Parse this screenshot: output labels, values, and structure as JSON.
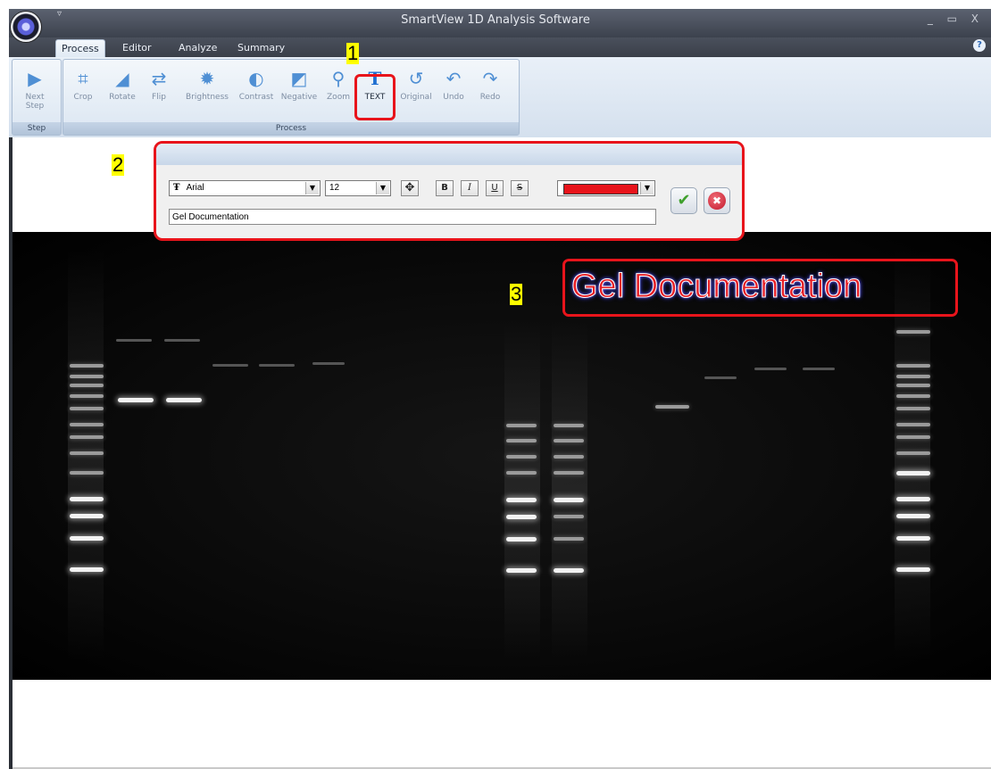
{
  "window": {
    "title": "SmartView 1D Analysis Software",
    "qat_glyph": "▿",
    "controls": "_ ▭ X"
  },
  "tabs": [
    {
      "label": "Process",
      "active": true
    },
    {
      "label": "Editor",
      "active": false
    },
    {
      "label": "Analyze",
      "active": false
    },
    {
      "label": "Summary",
      "active": false
    }
  ],
  "help_glyph": "?",
  "ribbon": {
    "step_group": {
      "label": "Step",
      "button": {
        "label_line1": "Next",
        "label_line2": "Step",
        "icon": "next-step-icon"
      }
    },
    "process_group": {
      "label": "Process",
      "buttons": [
        {
          "label": "Crop",
          "icon": "crop-icon"
        },
        {
          "label": "Rotate",
          "icon": "rotate-icon"
        },
        {
          "label": "Flip",
          "icon": "flip-icon"
        },
        {
          "label": "Brightness",
          "icon": "brightness-icon"
        },
        {
          "label": "Contrast",
          "icon": "contrast-icon"
        },
        {
          "label": "Negative",
          "icon": "negative-icon"
        },
        {
          "label": "Zoom",
          "icon": "zoom-icon"
        },
        {
          "label": "TEXT",
          "icon": "text-icon",
          "highlighted": true
        },
        {
          "label": "Original",
          "icon": "original-icon"
        },
        {
          "label": "Undo",
          "icon": "undo-icon"
        },
        {
          "label": "Redo",
          "icon": "redo-icon"
        }
      ]
    }
  },
  "markers": [
    "1",
    "2",
    "3"
  ],
  "text_dialog": {
    "font_glyph": "Ŧ",
    "font": "Arial",
    "size": "12",
    "move_glyph": "✥",
    "bold": "B",
    "italic": "I",
    "underline": "U",
    "strike": "S",
    "color": "#e8141b",
    "text_value": "Gel Documentation",
    "ok_glyph": "✔",
    "cancel_glyph": "✖",
    "dropdown_glyph": "▼"
  },
  "overlay": {
    "text": "Gel Documentation",
    "color": "#e51c24"
  },
  "colors": {
    "highlight_red": "#e8141b",
    "marker_yellow": "#ffff00"
  }
}
